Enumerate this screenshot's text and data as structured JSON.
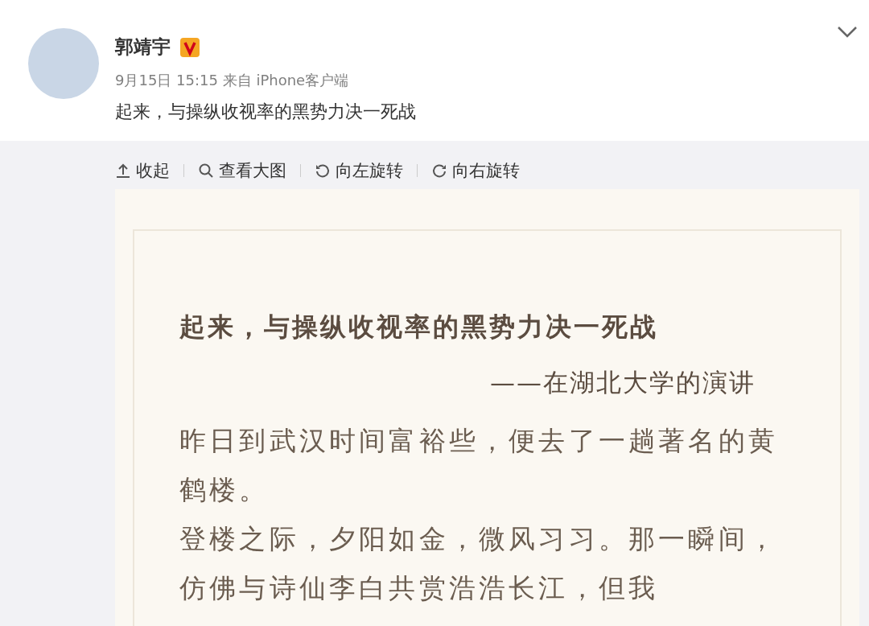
{
  "post": {
    "author": "郭靖宇",
    "verified": true,
    "meta": "9月15日 15:15 来自 iPhone客户端",
    "text": "起来，与操纵收视率的黑势力决一死战"
  },
  "toolbar": [
    {
      "kind": "collapse",
      "label": "收起"
    },
    {
      "kind": "view",
      "label": "查看大图"
    },
    {
      "kind": "rotate-left",
      "label": "向左旋转"
    },
    {
      "kind": "rotate-right",
      "label": "向右旋转"
    }
  ],
  "document": {
    "title": "起来，与操纵收视率的黑势力决一死战",
    "subtitle": "——在湖北大学的演讲",
    "paragraphs": [
      "昨日到武汉时间富裕些，便去了一趟著名的黄鹤楼。",
      "登楼之际，夕阳如金，微风习习。那一瞬间，仿佛与诗仙李白共赏浩浩长江，但我"
    ]
  }
}
